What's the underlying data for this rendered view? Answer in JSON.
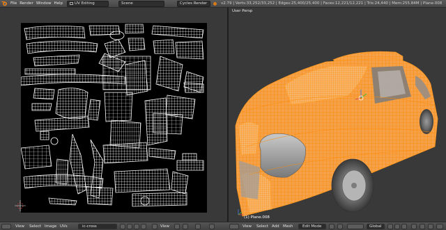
{
  "menu": {
    "file": "File",
    "render": "Render",
    "window": "Window",
    "help": "Help"
  },
  "layout_field": "UV Editing",
  "scene_field": "Scene",
  "engine_field": "Cycles Render",
  "stats": "v2.79 | Verts:33,252/33,252 | Edges:25,400/25,400 | Faces:12,221/12,221 | Tris:24,440 | Mem:255.84M | Plane.008",
  "viewport": {
    "view_label": "User Persp",
    "object_label": "(1) Plane.008"
  },
  "uv_footer": {
    "view": "View",
    "select": "Select",
    "image": "Image",
    "uvs": "UVs",
    "image_name": "ic-cross",
    "view2": "View"
  },
  "view3d_footer": {
    "view": "View",
    "select": "Select",
    "add": "Add",
    "mesh": "Mesh",
    "mode": "Edit Mode",
    "orientation": "Global"
  },
  "colors": {
    "accent": "#f5a623",
    "mesh_orange": "#ff9a1e",
    "background": "#393939"
  }
}
